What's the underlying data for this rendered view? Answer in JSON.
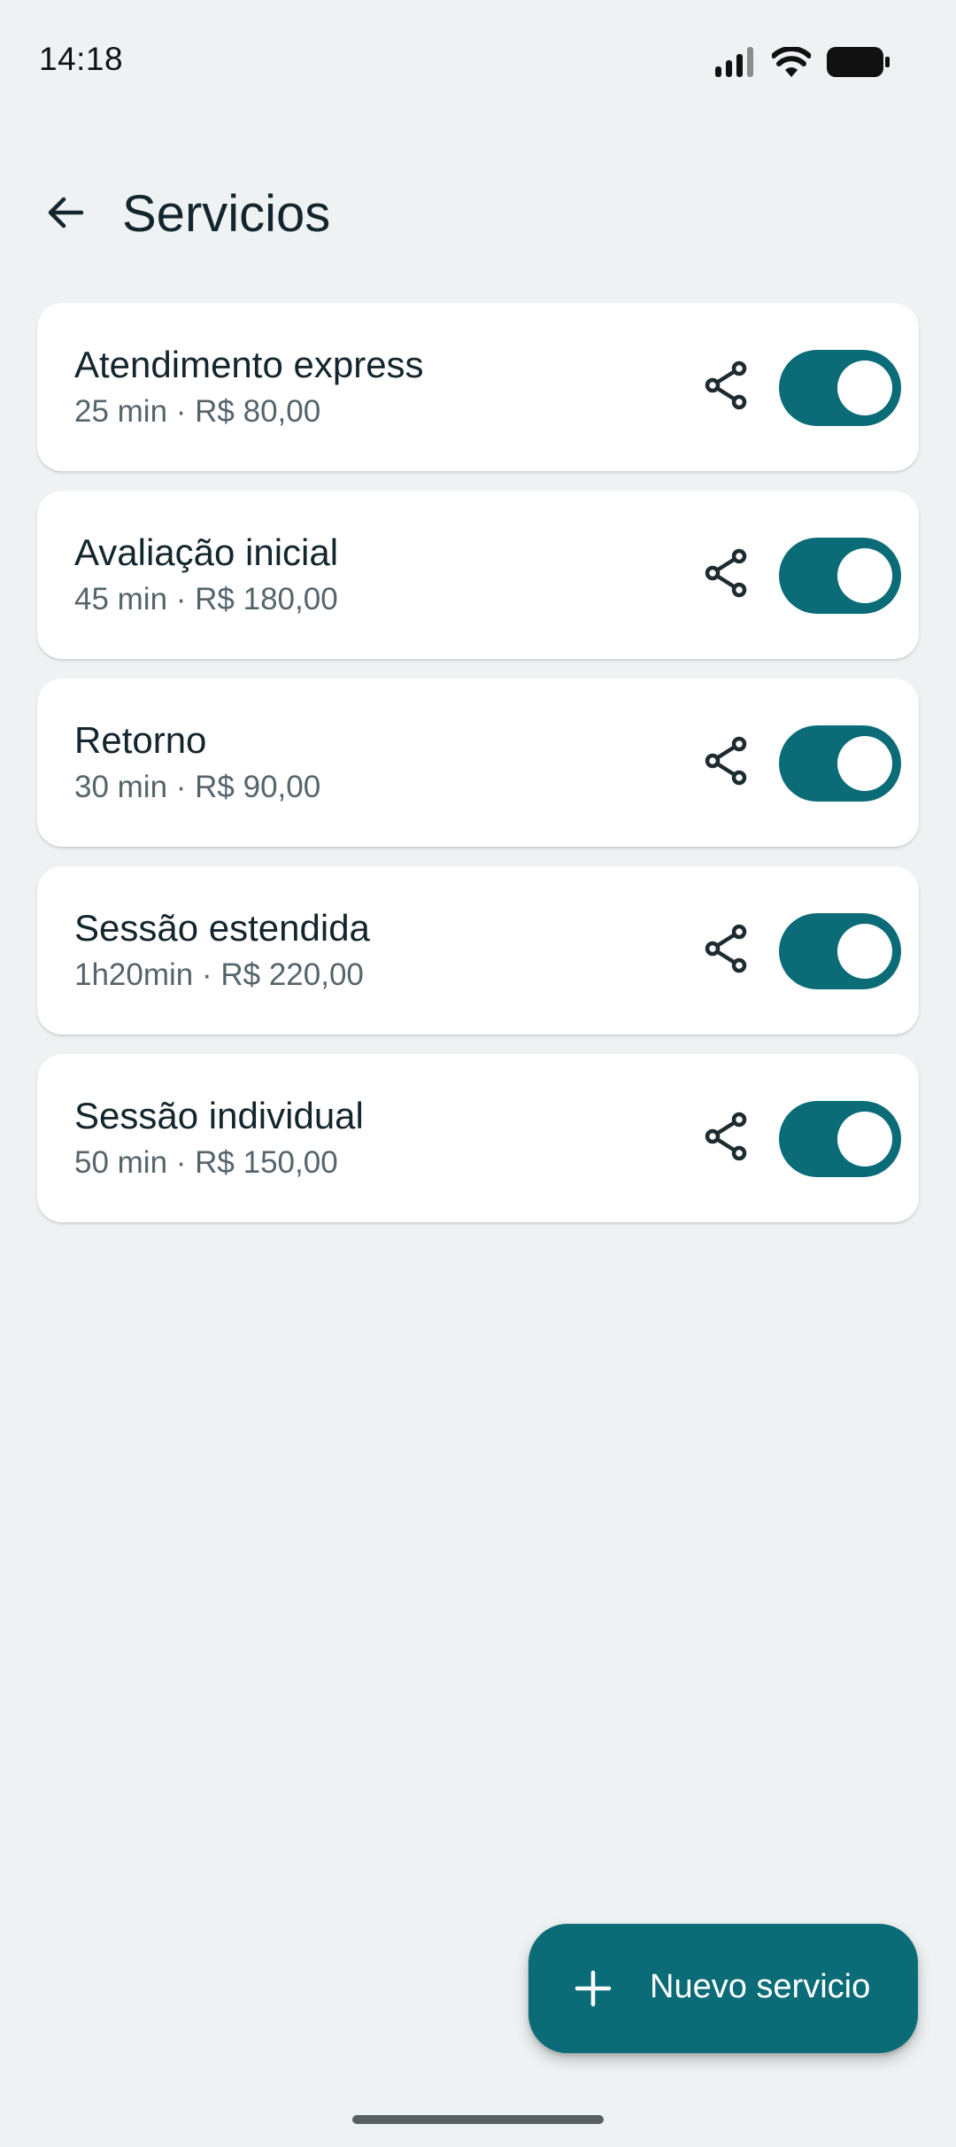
{
  "status_bar": {
    "time": "14:18",
    "icons": [
      "signal-icon",
      "wifi-icon",
      "battery-icon"
    ]
  },
  "app_bar": {
    "back_icon": "arrow-back-icon",
    "title": "Servicios"
  },
  "services": [
    {
      "name": "Atendimento express",
      "meta": "25 min · R$ 80,00",
      "enabled": true
    },
    {
      "name": "Avaliação inicial",
      "meta": "45 min · R$ 180,00",
      "enabled": true
    },
    {
      "name": "Retorno",
      "meta": "30 min · R$ 90,00",
      "enabled": true
    },
    {
      "name": "Sessão estendida",
      "meta": "1h20min · R$ 220,00",
      "enabled": true
    },
    {
      "name": "Sessão individual",
      "meta": "50 min · R$ 150,00",
      "enabled": true
    }
  ],
  "fab": {
    "icon": "plus-icon",
    "label": "Nuevo servicio"
  },
  "colors": {
    "background": "#EEF2F3",
    "card": "#FFFFFF",
    "accent": "#0B6C78",
    "title_text": "#14262D",
    "secondary_text": "#55656B"
  }
}
